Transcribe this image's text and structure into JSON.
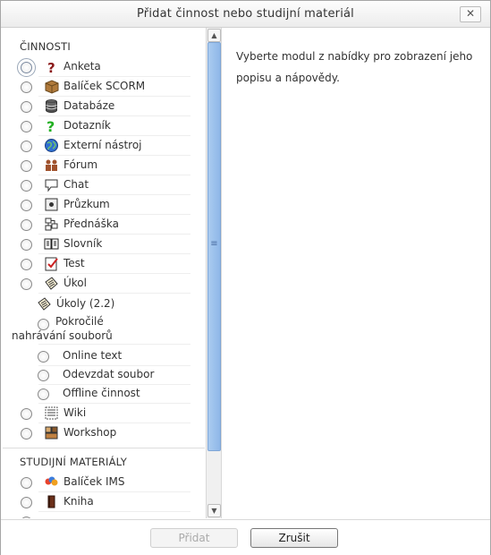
{
  "dialog": {
    "title": "Přidat činnost nebo studijní materiál",
    "close_label": "✕"
  },
  "sections": {
    "activities": "ČINNOSTI",
    "resources": "STUDIJNÍ MATERIÁLY"
  },
  "activities": [
    {
      "label": "Anketa",
      "icon": "question-icon"
    },
    {
      "label": "Balíček SCORM",
      "icon": "package-icon"
    },
    {
      "label": "Databáze",
      "icon": "database-icon"
    },
    {
      "label": "Dotazník",
      "icon": "question-green-icon"
    },
    {
      "label": "Externí nástroj",
      "icon": "globe-icon"
    },
    {
      "label": "Fórum",
      "icon": "forum-icon"
    },
    {
      "label": "Chat",
      "icon": "chat-icon"
    },
    {
      "label": "Průzkum",
      "icon": "survey-icon"
    },
    {
      "label": "Přednáška",
      "icon": "lesson-icon"
    },
    {
      "label": "Slovník",
      "icon": "glossary-icon"
    },
    {
      "label": "Test",
      "icon": "quiz-icon"
    },
    {
      "label": "Úkol",
      "icon": "assignment-icon"
    }
  ],
  "assignments_22": {
    "label": "Úkoly (2.2)",
    "icon": "assignment-icon",
    "items": [
      "Pokročilé nahrávání souborů",
      "Online text",
      "Odevzdat soubor",
      "Offline činnost"
    ]
  },
  "activities_after": [
    {
      "label": "Wiki",
      "icon": "wiki-icon"
    },
    {
      "label": "Workshop",
      "icon": "workshop-icon"
    }
  ],
  "resources": [
    {
      "label": "Balíček IMS",
      "icon": "ims-icon"
    },
    {
      "label": "Kniha",
      "icon": "book-icon"
    }
  ],
  "help": {
    "text": "Vyberte modul z nabídky pro zobrazení jeho popisu a nápovědy."
  },
  "footer": {
    "add_label": "Přidat",
    "cancel_label": "Zrušit"
  }
}
